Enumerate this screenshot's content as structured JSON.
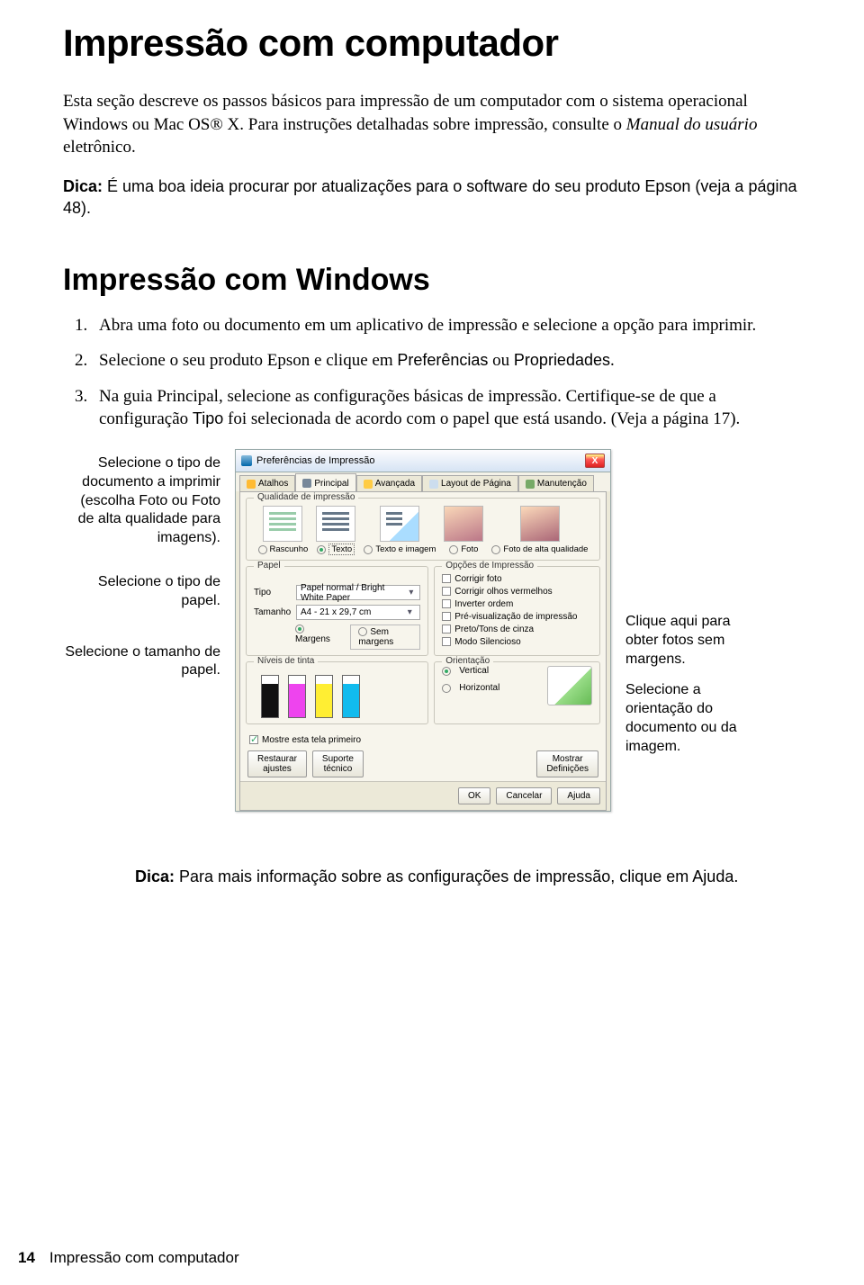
{
  "title": "Impressão com computador",
  "intro_1": "Esta seção descreve os passos básicos para impressão de um computador com o sistema operacional Windows ou Mac OS® X. Para instruções detalhadas sobre impressão, consulte o ",
  "intro_emph": "Manual do usuário",
  "intro_2": " eletrônico.",
  "tip_label": "Dica:",
  "tip_text": " É uma boa ideia procurar por atualizações para o software do seu produto Epson (veja a página 48).",
  "section": "Impressão com Windows",
  "steps": {
    "s1": "Abra uma foto ou documento em um aplicativo de impressão e selecione a opção para imprimir.",
    "s2a": "Selecione o seu produto Epson e clique em ",
    "s2b": "Preferências",
    "s2c": " ou ",
    "s2d": "Propriedades",
    "s2e": ".",
    "s3a": "Na guia Principal, selecione as configurações básicas de impressão. Certifique-se de que a configuração ",
    "s3b": "Tipo",
    "s3c": " foi selecionada de acordo com o papel que está usando. (Veja a página 17)."
  },
  "callouts_left": {
    "c1a": "Selecione o tipo de documento a imprimir (escolha ",
    "c1b": "Foto",
    "c1c": " ou ",
    "c1d": "Foto de alta qualidade",
    "c1e": " para imagens).",
    "c2": "Selecione o tipo de papel.",
    "c3": "Selecione o tamanho de papel."
  },
  "callouts_right": {
    "r1": "Clique aqui para obter fotos sem margens.",
    "r2": "Selecione a orientação do documento ou da imagem."
  },
  "dialog": {
    "title": "Preferências de Impressão",
    "close": "X",
    "tabs": [
      "Atalhos",
      "Principal",
      "Avançada",
      "Layout de Página",
      "Manutenção"
    ],
    "grp_quality": "Qualidade de impressão",
    "quality": [
      "Rascunho",
      "Texto",
      "Texto e imagem",
      "Foto",
      "Foto de alta qualidade"
    ],
    "grp_paper": "Papel",
    "lbl_type": "Tipo",
    "val_type": "Papel normal / Bright White Paper",
    "lbl_size": "Tamanho",
    "val_size": "A4 - 21 x 29,7 cm",
    "margins": "Margens",
    "borderless": "Sem margens",
    "grp_printopts": "Opções de Impressão",
    "opts": [
      "Corrigir foto",
      "Corrigir olhos vermelhos",
      "Inverter ordem",
      "Pré-visualização de impressão",
      "Preto/Tons de cinza",
      "Modo Silencioso"
    ],
    "grp_ink": "Níveis de tinta",
    "grp_orient": "Orientação",
    "orient_v": "Vertical",
    "orient_h": "Horizontal",
    "showfirst": "Mostre esta tela primeiro",
    "btn_restore": "Restaurar ajustes",
    "btn_support": "Suporte técnico",
    "btn_showdef": "Mostrar Definições",
    "btn_ok": "OK",
    "btn_cancel": "Cancelar",
    "btn_help": "Ajuda"
  },
  "bottom_tip_label": "Dica:",
  "bottom_tip_a": " Para mais informação sobre as configurações de impressão, clique em ",
  "bottom_tip_b": "Ajuda",
  "bottom_tip_c": ".",
  "footer_page": "14",
  "footer_text": "Impressão com computador"
}
